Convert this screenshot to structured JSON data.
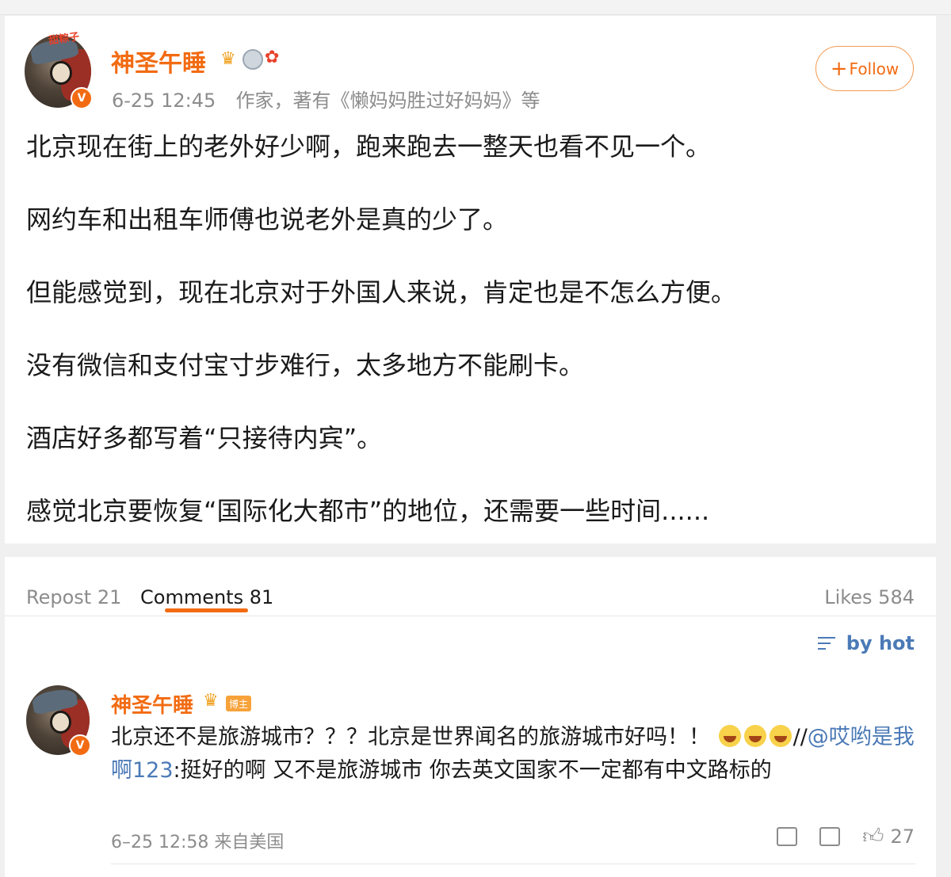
{
  "post": {
    "author": "神圣午睡",
    "avatar_text": "甜粽子",
    "verify_mark": "V",
    "time": "6-25 12:45",
    "description": "作家，著有《懒妈妈胜过好妈妈》等",
    "follow_label": "Follow",
    "paragraphs": [
      "北京现在街上的老外好少啊，跑来跑去一整天也看不见一个。",
      "网约车和出租车师傅也说老外是真的少了。",
      "但能感觉到，现在北京对于外国人来说，肯定也是不怎么方便。",
      "没有微信和支付宝寸步难行，太多地方不能刷卡。",
      "酒店好多都写着“只接待内宾”。",
      "感觉北京要恢复“国际化大都市”的地位，还需要一些时间......"
    ]
  },
  "tabs": {
    "repost": "Repost 21",
    "comments": "Comments 81",
    "likes": "Likes 584"
  },
  "sort_label": "by hot",
  "comment": {
    "author": "神圣午睡",
    "tag": "博主",
    "text_before": "北京还不是旅游城市？？？北京是世界闻名的旅游城市好吗！！",
    "separator": "//",
    "mention": "@哎哟是我啊123",
    "text_after": ":挺好的啊 又不是旅游城市 你去英文国家不一定都有中文路标的",
    "meta": "6–25 12:58 来自美国",
    "likes": "27"
  },
  "colors": {
    "accent": "#f26b12",
    "link": "#4b7ab7",
    "muted": "#8c8c8c"
  }
}
